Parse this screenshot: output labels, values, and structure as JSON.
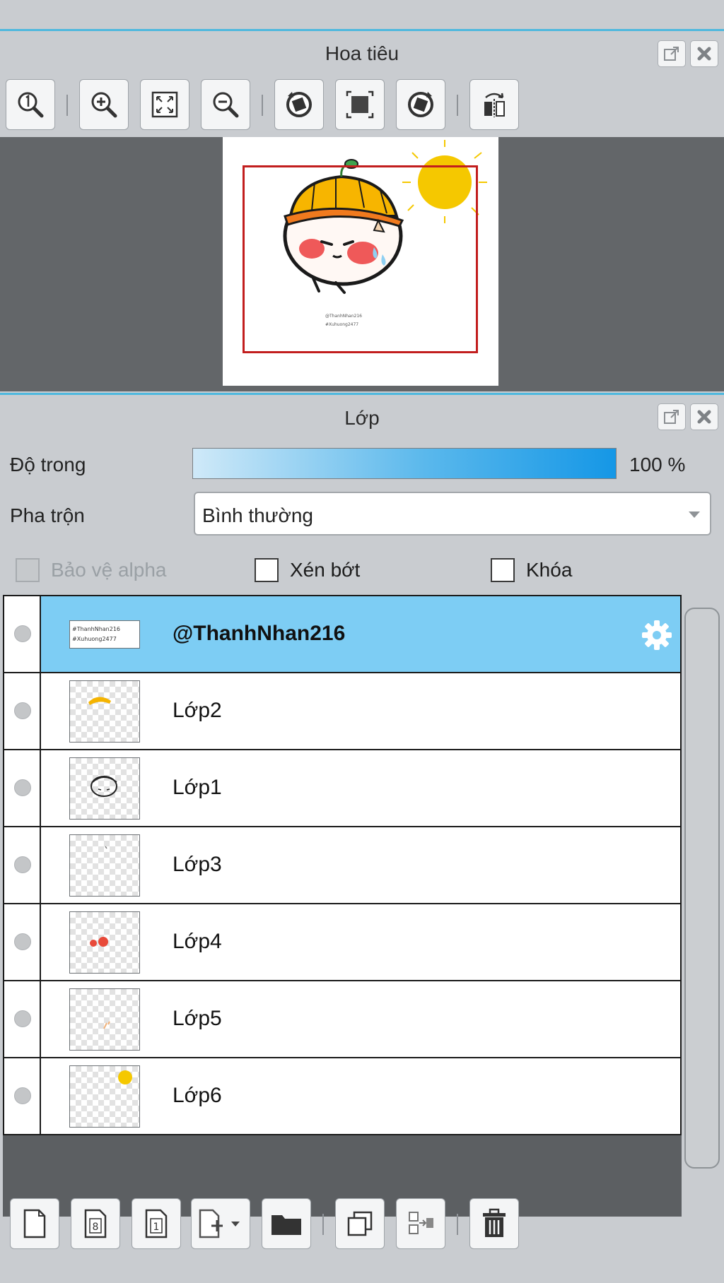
{
  "navigator": {
    "title": "Hoa tiêu",
    "toolbar": [
      "zoom-actual-icon",
      "zoom-in-icon",
      "fit-window-icon",
      "zoom-out-icon",
      "rotate-left-icon",
      "reset-rotation-icon",
      "rotate-right-icon",
      "flip-horizontal-icon"
    ],
    "watermark_lines": [
      "@ThanhNhan216",
      "#Xuhuong2477"
    ]
  },
  "layers_panel": {
    "title": "Lớp",
    "opacity_label": "Độ trong",
    "opacity_value": "100 %",
    "opacity_level": 1.0,
    "blend_label": "Pha trộn",
    "blend_value": "Bình thường",
    "checkboxes": {
      "protect_alpha": "Bảo vệ alpha",
      "clipping": "Xén bớt",
      "lock": "Khóa"
    },
    "layers": [
      {
        "name": "@ThanhNhan216",
        "selected": true
      },
      {
        "name": "Lớp2"
      },
      {
        "name": "Lớp1"
      },
      {
        "name": "Lớp3"
      },
      {
        "name": "Lớp4"
      },
      {
        "name": "Lớp5"
      },
      {
        "name": "Lớp6"
      }
    ],
    "thumb_text": [
      "#ThanhNhan216",
      "#Xuhuong2477"
    ],
    "bottom_toolbar": [
      "new-layer-icon",
      "new-8bit-layer-icon",
      "new-1bit-layer-icon",
      "add-layer-dropdown-icon",
      "new-folder-icon",
      "duplicate-layer-icon",
      "merge-down-icon",
      "delete-layer-icon"
    ]
  },
  "colors": {
    "accent_line": "#4fb8de",
    "selected_row": "#7dcdf4",
    "viewport_rect": "#c21e1e",
    "canvas_bg": "#636669"
  }
}
